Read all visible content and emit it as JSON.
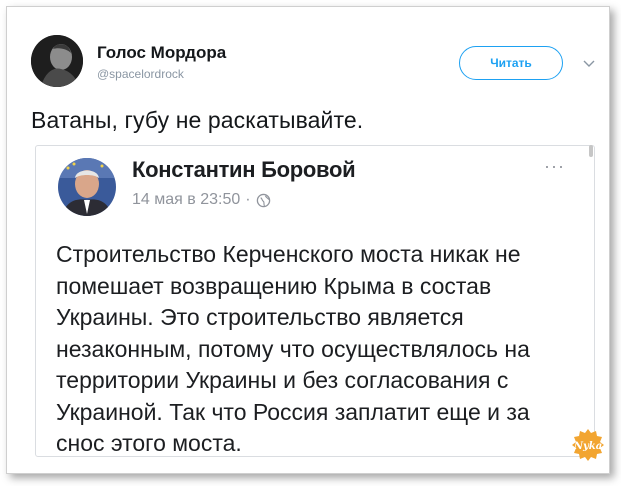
{
  "tweet": {
    "author_name": "Голос Мордора",
    "author_handle": "@spacelordrock",
    "follow_label": "Читать",
    "text": "Ватаны, губу не раскатывайте."
  },
  "quote": {
    "author_name": "Константин Боровой",
    "date": "14 мая в 23:50",
    "separator": "·",
    "more_label": "···",
    "body": "Строительство Керченского моста никак не помешает возвращению Крыма в состав Украины. Это строительство является незаконным, потому что осуществлялось на территории Украины и без согласования с Украиной. Так что Россия заплатит еще и за снос этого моста."
  },
  "watermark": {
    "text": "Nyka"
  },
  "colors": {
    "accent": "#1da1f2",
    "text": "#14171a",
    "muted": "#8a96a3",
    "logo": "#f2a531"
  },
  "icons": {
    "caret": "chevron-down-icon",
    "privacy": "globe-icon"
  }
}
